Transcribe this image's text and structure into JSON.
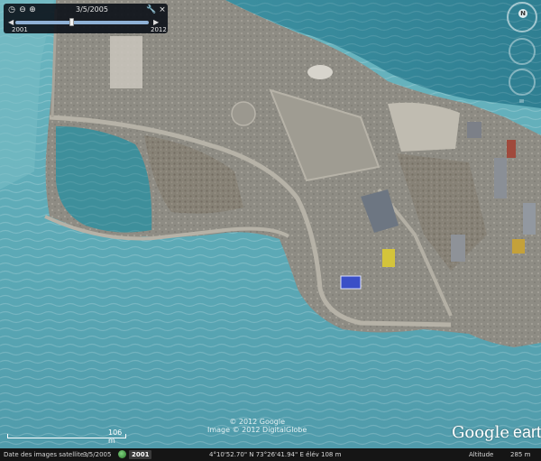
{
  "time_slider": {
    "current_date": "3/5/2005",
    "start_year": "2001",
    "end_year": "2012",
    "position_fraction": 0.42
  },
  "icons": {
    "clock": "clock-icon",
    "zoom_out": "zoom-out-icon",
    "zoom_in": "zoom-in-icon",
    "wrench": "wrench-icon",
    "close": "close-icon",
    "compass_north": "compass-north-icon"
  },
  "nav": {
    "north_label": "N"
  },
  "copyright": {
    "line1": "© 2012 Google",
    "line2": "Image © 2012 DigitalGlobe"
  },
  "scale": {
    "label": "106 m"
  },
  "logo": {
    "google": "Google",
    "earth": "earth"
  },
  "status_bar": {
    "imagery_date_label": "Date des images satellite :",
    "imagery_date_value": "3/5/2005",
    "year_badge": "2001",
    "coordinates": "4°10'52.70\" N   73°26'41.94\" E  élév  108 m",
    "altitude_label": "Altitude",
    "altitude_value": "285 m"
  },
  "colors": {
    "sea": "#5fa9b4",
    "deep_sea": "#3f8e9e",
    "land": "#8c8a82",
    "panel": "#0c101a"
  }
}
